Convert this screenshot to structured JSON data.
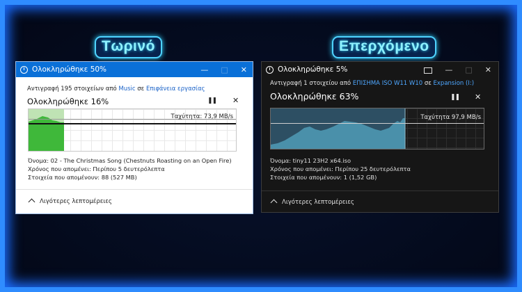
{
  "headings": {
    "left": "Τωρινό",
    "right": "Επερχόμενο"
  },
  "colors": {
    "frame": "#2f8cff",
    "light_titlebar": "#0a70d8",
    "light_graph_fill": "#3fb83a",
    "dark_graph_fill": "#4a90aa",
    "link_light": "#1b63c8",
    "link_dark": "#4ea7ff"
  },
  "current": {
    "title": "Ολοκληρώθηκε 50%",
    "desc_prefix": "Αντιγραφή 195 στοιχείων από",
    "source": "Music",
    "desc_mid": "σε",
    "destination": "Επιφάνεια εργασίας",
    "percent_label": "Ολοκληρώθηκε 16%",
    "progress": 0.16,
    "speed": "Ταχύτητα: 73,9 MB/s",
    "name_line": "Όνομα: 02 - The Christmas Song (Chestnuts Roasting on an Open Fire)",
    "time_line": "Χρόνος που απομένει: Περίπου 5 δευτερόλεπτα",
    "items_line": "Στοιχεία που απομένουν: 88 (527 MB)",
    "fewer_details": "Λιγότερες λεπτομέρειες",
    "icons": {
      "title": "clock-icon",
      "minimize": "minimize-icon",
      "maximize": "maximize-icon",
      "close": "close-icon",
      "pause": "pause-icon",
      "cancel": "close-icon",
      "chevron": "chevron-up-icon"
    }
  },
  "upcoming": {
    "title": "Ολοκληρώθηκε 5%",
    "desc_prefix": "Αντιγραφή 1 στοιχείου από",
    "source": "ΕΠΙΣΗΜΑ ISO W11 W10",
    "desc_mid": "σε",
    "destination": "Expansion (I:)",
    "percent_label": "Ολοκληρώθηκε 63%",
    "progress": 0.63,
    "speed": "Ταχύτητα 97,9 MB/s",
    "name_line": "Όνομα: tiny11 23H2 x64.iso",
    "time_line": "Χρόνος που απομένει: Περίπου 25 δευτερόλεπτα",
    "items_line": "Στοιχεία που απομένουν: 1 (1,52 GB)",
    "fewer_details": "Λιγότερες λεπτομέρειες",
    "icons": {
      "title": "clock-icon",
      "compact": "compact-view-icon",
      "minimize": "minimize-icon",
      "maximize": "maximize-icon",
      "close": "close-icon",
      "pause": "pause-icon",
      "cancel": "close-icon",
      "chevron": "chevron-up-icon"
    }
  }
}
